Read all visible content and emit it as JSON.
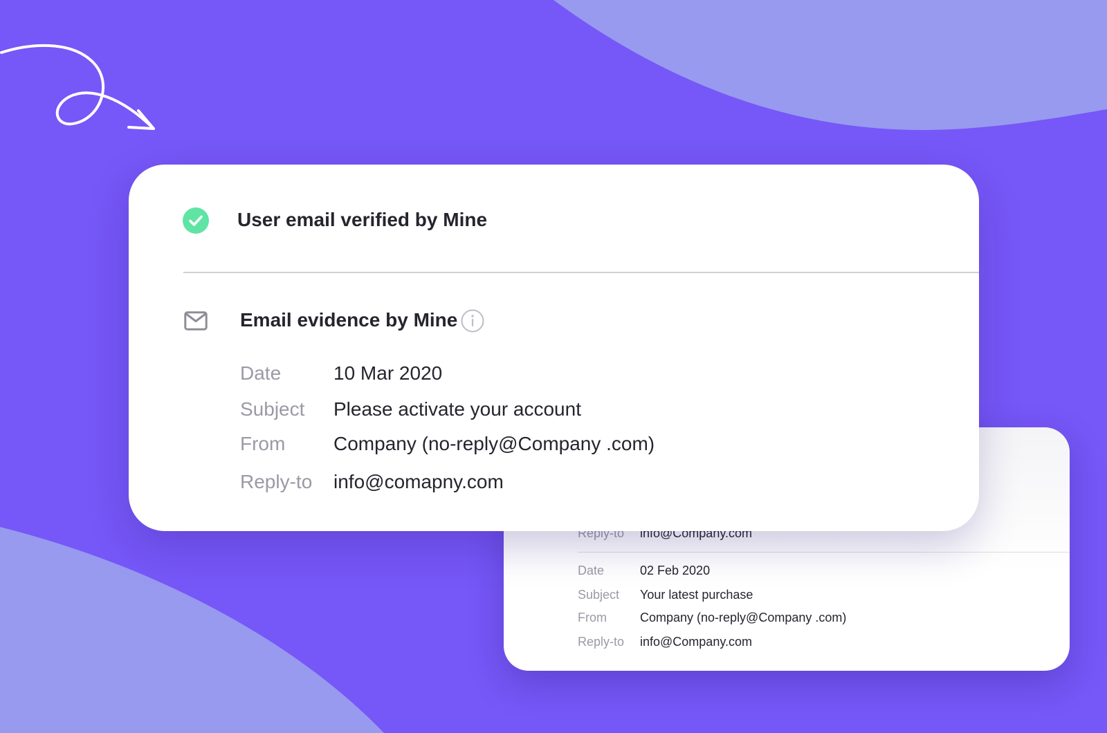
{
  "colors": {
    "background": "#7657f7",
    "blob": "#979aef",
    "card": "#ffffff",
    "verified_green": "#5fe4a4",
    "text_dark": "#25252e",
    "text_muted": "#9a9aa6"
  },
  "verified": {
    "icon": "check-circle-icon",
    "title": "User email verified by Mine"
  },
  "evidence": {
    "icon": "envelope-icon",
    "info_icon": "info-icon",
    "title": "Email evidence by Mine",
    "fields": [
      {
        "label": "Date",
        "value": "10 Mar 2020"
      },
      {
        "label": "Subject",
        "value": "Please activate your account"
      },
      {
        "label": "From",
        "value": "Company (no-reply@Company .com)"
      },
      {
        "label": "Reply-to",
        "value": "info@comapny.com"
      }
    ]
  },
  "back_card": {
    "partial_field": {
      "label": "Reply-to",
      "value": "info@Company.com"
    },
    "fields": [
      {
        "label": "Date",
        "value": "02 Feb 2020"
      },
      {
        "label": "Subject",
        "value": "Your latest purchase"
      },
      {
        "label": "From",
        "value": "Company (no-reply@Company .com)"
      },
      {
        "label": "Reply-to",
        "value": "info@Company.com"
      }
    ]
  }
}
